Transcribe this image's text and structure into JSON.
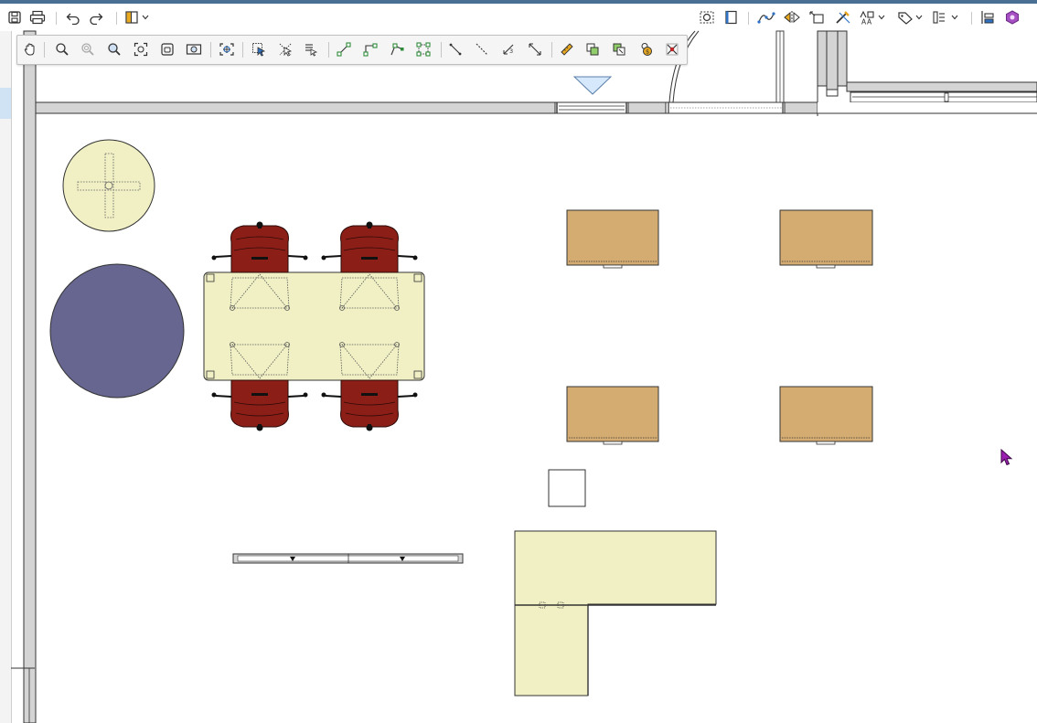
{
  "window": {
    "accent_color": "#4a6f94"
  },
  "toolbar": {
    "left_icons": [
      "save-icon",
      "print-icon",
      "undo-icon",
      "redo-icon",
      "view-layout-icon"
    ],
    "right_icons": [
      "zoom-selection-icon",
      "library-book-icon",
      "spline-tool-icon",
      "mirror-icon",
      "transform-icon",
      "edit-tools-icon",
      "text-style-icon",
      "tag-icon",
      "schedule-icon",
      "structure-icon",
      "3d-object-icon"
    ]
  },
  "floating_toolbar": {
    "icons": [
      "pan-hand-icon",
      "zoom-in-icon",
      "zoom-out-icon",
      "zoom-window-icon",
      "fill-window-icon",
      "zoom-previous-icon",
      "camera-view-icon",
      "center-view-icon",
      "select-icon",
      "deselect-icon",
      "select-by-type-icon",
      "line-tool-icon",
      "polyline-tool-icon",
      "edit-point-icon",
      "edit-area-icon",
      "draw-line-icon",
      "dashed-line-icon",
      "dimension-icon",
      "angle-dimension-icon",
      "measure-ruler-icon",
      "copy-object-icon",
      "replace-object-icon",
      "cost-estimate-icon",
      "delete-icon"
    ]
  },
  "plan": {
    "table_color": "#f0f0c4",
    "round_rug_color": "#666690",
    "desk_color": "#d4ac72",
    "chair_color": "#8b1e16",
    "wall_color": "#d4d4d4"
  },
  "cursor": {
    "color": "#9b1fb0"
  }
}
